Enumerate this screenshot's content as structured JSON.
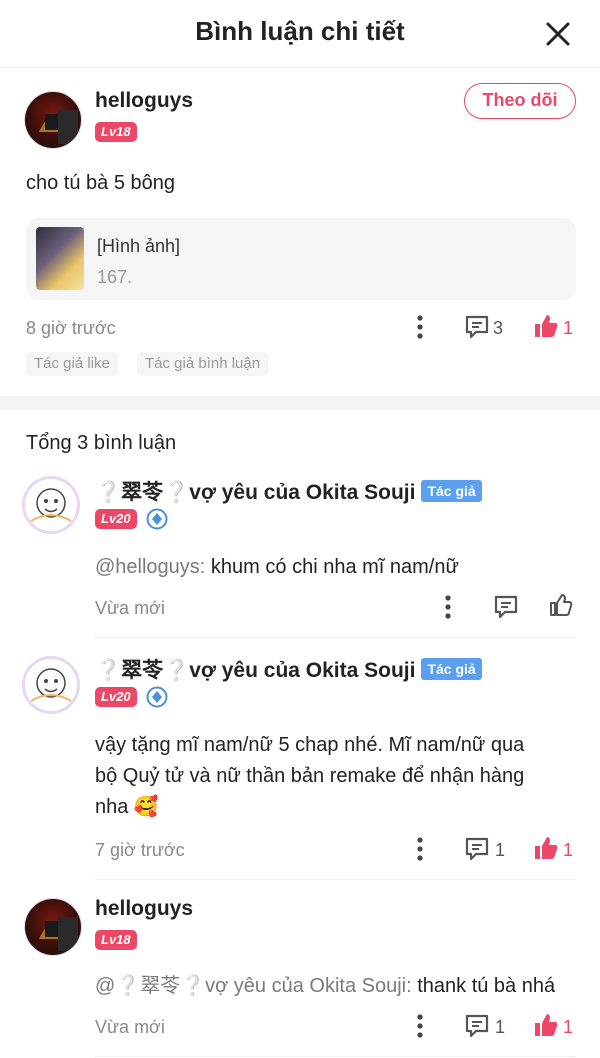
{
  "header": {
    "title": "Bình luận chi tiết"
  },
  "main_comment": {
    "username": "helloguys",
    "level": "Lv18",
    "follow_label": "Theo dõi",
    "text": "cho tú bà 5 bông",
    "image_card": {
      "line1": "[Hình ảnh]",
      "line2": "167."
    },
    "time": "8 giờ trước",
    "comment_count": "3",
    "like_count": "1",
    "tags": [
      "Tác giả like",
      "Tác giả bình luận"
    ]
  },
  "total_label": "Tổng 3 bình luận",
  "replies": [
    {
      "username": "❔翠苓❔vợ yêu của Okita Souji",
      "author_tag": "Tác giả",
      "level": "Lv20",
      "mention": "@helloguys:",
      "text": " khum có chi nha mĩ nam/nữ",
      "time": "Vừa mới"
    },
    {
      "username": "❔翠苓❔vợ yêu của Okita Souji",
      "author_tag": "Tác giả",
      "level": "Lv20",
      "line1": "vậy tặng mĩ nam/nữ 5 chap nhé. Mĩ nam/nữ qua",
      "line2": "bộ Quỷ tử và nữ thần bản remake để nhận hàng",
      "line3": "nha 🥰",
      "time": "7 giờ trước",
      "comment_count": "1",
      "like_count": "1"
    },
    {
      "username": "helloguys",
      "level": "Lv18",
      "mention": "@❔翠苓❔vợ yêu của Okita Souji:",
      "text": " thank tú bà nhá",
      "time": "Vừa mới",
      "comment_count": "1",
      "like_count": "1"
    }
  ],
  "colors": {
    "accent": "#ec4766",
    "author_tag": "#5aa0ef",
    "muted": "#888888"
  }
}
